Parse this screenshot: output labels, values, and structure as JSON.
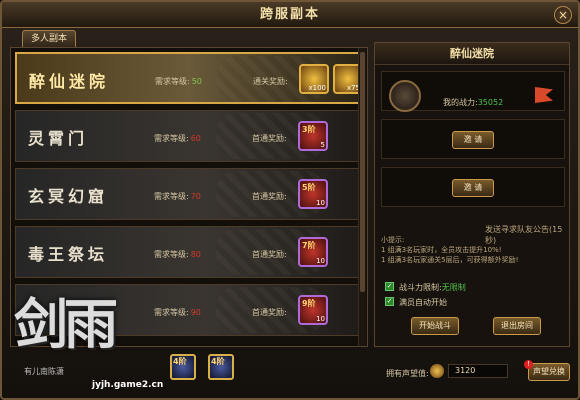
{
  "title": "跨服副本",
  "close_label": "×",
  "tab_label": "多人副本",
  "dungeons": [
    {
      "name": "醉仙迷院",
      "req_label": "需求等级:",
      "req_value": "50",
      "reward_label": "通关奖励:",
      "items": [
        {
          "lv": "",
          "cnt": "x100"
        },
        {
          "lv": "",
          "cnt": "x75"
        }
      ]
    },
    {
      "name": "灵霄门",
      "req_label": "需求等级:",
      "req_value": "60",
      "reward_label": "首通奖励:",
      "items": [
        {
          "lv": "3阶",
          "cnt": "5"
        }
      ]
    },
    {
      "name": "玄冥幻窟",
      "req_label": "需求等级:",
      "req_value": "70",
      "reward_label": "首通奖励:",
      "items": [
        {
          "lv": "5阶",
          "cnt": "10"
        }
      ]
    },
    {
      "name": "毒王祭坛",
      "req_label": "需求等级:",
      "req_value": "80",
      "reward_label": "首通奖励:",
      "items": [
        {
          "lv": "7阶",
          "cnt": "10"
        }
      ]
    },
    {
      "name": "",
      "req_label": "需求等级:",
      "req_value": "90",
      "reward_label": "首通奖励:",
      "items": [
        {
          "lv": "9阶",
          "cnt": "10"
        }
      ]
    }
  ],
  "right": {
    "title": "醉仙迷院",
    "power_label": "我的战力:",
    "power_value": "35052",
    "invite1": "邀 请",
    "invite2": "邀 请",
    "announce": "发送寻求队友公告(15秒)",
    "tips": [
      "小提示:",
      "1 组满3名玩家时，全员攻击提升10%!",
      "1 组满3名玩家通关5层后，可获得额外奖励!"
    ],
    "limit_label": "战斗力限制:",
    "limit_value": "无限制",
    "auto_label": "满员自动开始",
    "start_btn": "开始战斗",
    "leave_btn": "退出房间"
  },
  "bottom": {
    "items": [
      {
        "lv": "4阶",
        "cnt": ""
      },
      {
        "lv": "4阶",
        "cnt": ""
      }
    ],
    "honor_label": "拥有声望值:",
    "honor_value": "3120",
    "shop_label": "声望兑换"
  },
  "logo": {
    "main": "剑雨",
    "sub": "有儿南陈潇",
    "site": "jyjh.game2.cn"
  }
}
